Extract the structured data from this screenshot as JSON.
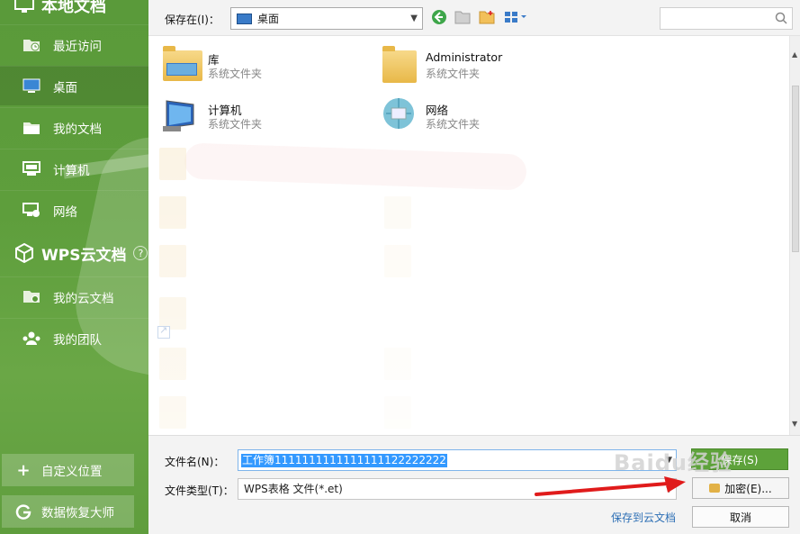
{
  "sidebar": {
    "local_title": "本地文档",
    "items": [
      {
        "label": "最近访问",
        "icon": "recent-folder-icon"
      },
      {
        "label": "桌面",
        "icon": "desktop-icon"
      },
      {
        "label": "我的文档",
        "icon": "folder-icon"
      },
      {
        "label": "计算机",
        "icon": "computer-icon"
      },
      {
        "label": "网络",
        "icon": "network-icon"
      }
    ],
    "cloud_title": "WPS云文档",
    "cloud_help": "?",
    "cloud_items": [
      {
        "label": "我的云文档",
        "icon": "cloud-folder-icon"
      },
      {
        "label": "我的团队",
        "icon": "team-icon"
      }
    ],
    "custom_location": "自定义位置",
    "recovery": "数据恢复大师"
  },
  "toolbar": {
    "save_in_label": "保存在(I)：",
    "location": "桌面",
    "search_placeholder": ""
  },
  "files": [
    {
      "name": "库",
      "type": "系统文件夹",
      "icon": "library-icon"
    },
    {
      "name": "Administrator",
      "type": "系统文件夹",
      "icon": "user-folder-icon"
    },
    {
      "name": "计算机",
      "type": "系统文件夹",
      "icon": "computer-icon"
    },
    {
      "name": "网络",
      "type": "系统文件夹",
      "icon": "network-icon"
    }
  ],
  "form": {
    "filename_label": "文件名(N)：",
    "filename_value": "工作簿1111111111111111122222222",
    "filetype_label": "文件类型(T)：",
    "filetype_value": "WPS表格 文件(*.et)",
    "save_button": "保存(S)",
    "encrypt_button": "加密(E)...",
    "cancel_button": "取消",
    "cloud_save_link": "保存到云文档"
  },
  "watermark": "Baidu经验"
}
